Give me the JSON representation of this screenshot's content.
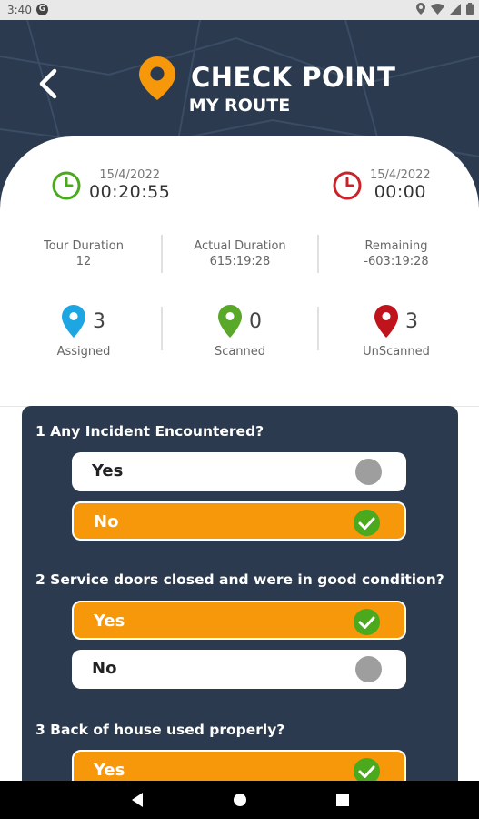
{
  "status_bar": {
    "time": "3:40",
    "g_icon": "G"
  },
  "header": {
    "app_title": "CHECK POINT",
    "page_title": "MY ROUTE"
  },
  "timers": {
    "start": {
      "date": "15/4/2022",
      "time": "00:20:55",
      "color": "#4aa91c"
    },
    "end": {
      "date": "15/4/2022",
      "time": "00:00",
      "color": "#c8232b"
    }
  },
  "durations": [
    {
      "label": "Tour Duration",
      "value": "12"
    },
    {
      "label": "Actual Duration",
      "value": "615:19:28"
    },
    {
      "label": "Remaining",
      "value": "-603:19:28"
    }
  ],
  "counts": [
    {
      "label": "Assigned",
      "value": "3",
      "color": "#1ea6e3"
    },
    {
      "label": "Scanned",
      "value": "0",
      "color": "#5aa82a"
    },
    {
      "label": "UnScanned",
      "value": "3",
      "color": "#c0141c"
    }
  ],
  "questions": [
    {
      "text": "1 Any Incident Encountered?",
      "options": [
        {
          "label": "Yes",
          "selected": false
        },
        {
          "label": "No",
          "selected": true
        }
      ]
    },
    {
      "text": "2 Service doors closed and were in good condition?",
      "options": [
        {
          "label": "Yes",
          "selected": true
        },
        {
          "label": "No",
          "selected": false
        }
      ]
    },
    {
      "text": "3 Back of house used properly?",
      "options": [
        {
          "label": "Yes",
          "selected": true
        }
      ]
    }
  ],
  "colors": {
    "navy": "#2b3a4e",
    "accent": "#f7980b",
    "check": "#4aa91c"
  }
}
